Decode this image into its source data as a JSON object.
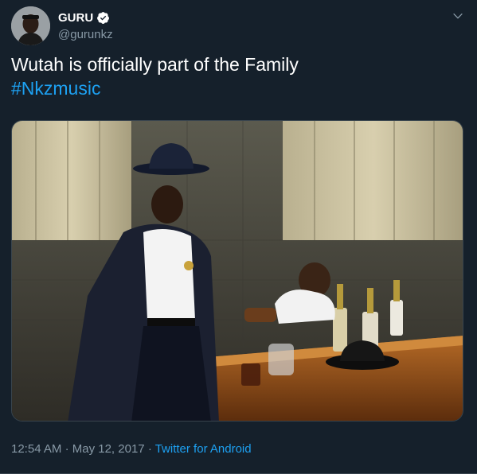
{
  "user": {
    "display_name": "GURU",
    "handle": "@gurunkz",
    "verified": true
  },
  "tweet": {
    "text": "Wutah is officially part of the Family",
    "hashtag": "#Nkzmusic"
  },
  "meta": {
    "time": "12:54 AM",
    "separator": "·",
    "date": "May 12, 2017",
    "source": "Twitter for Android"
  },
  "colors": {
    "background": "#15202b",
    "accent": "#1da1f2",
    "secondary_text": "#8899a6"
  },
  "icons": {
    "verified": "verified-badge-icon",
    "more": "chevron-down-icon"
  }
}
